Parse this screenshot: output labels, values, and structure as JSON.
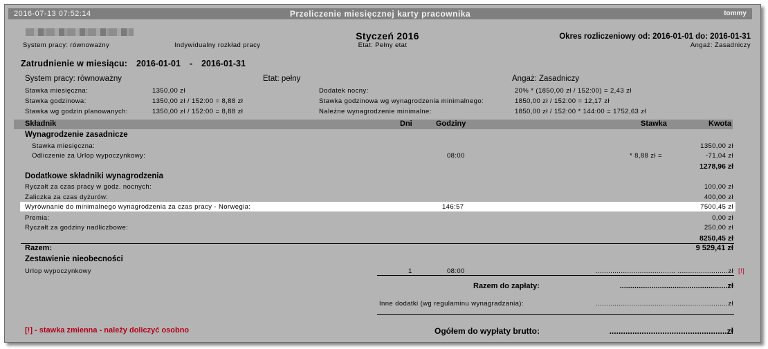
{
  "window": {
    "datetime": "2016-07-13  07:52:14",
    "title": "Przeliczenie miesięcznej karty pracownika",
    "user": "tommy"
  },
  "header": {
    "month": "Styczeń 2016",
    "etat": "Etat: Pełny etat",
    "system": "System pracy: równoważny",
    "rozklad": "Indywidualny rozkład pracy",
    "okres": "Okres rozliczeniowy od: 2016-01-01 do: 2016-01-31",
    "angaz": "Angaż: Zasadniczy"
  },
  "employment": {
    "label": "Zatrudnienie w miesiącu:",
    "from": "2016-01-01",
    "sep": "-",
    "to": "2016-01-31"
  },
  "summary": {
    "system": "System pracy: równoważny",
    "etat": "Etat: pełny",
    "angaz": "Angaż: Zasadniczy",
    "stawka_mies_l": "Stawka miesięczna:",
    "stawka_mies_v": "1350,00 zł",
    "stawka_godz_l": "Stawka godzinowa:",
    "stawka_godz_v": "1350,00 zł / 152:00 = 8,88 zł",
    "stawka_plan_l": "Stawka wg godzin planowanych:",
    "stawka_plan_v": "1350,00 zł / 152:00 = 8,88 zł",
    "dodatek_l": "Dodatek nocny:",
    "dodatek_v": "20% * (1850,00 zł / 152:00) = 2,43 zł",
    "stawka_min_l": "Stawka godzinowa wg wynagrodzenia minimalnego:",
    "stawka_min_v": "1850,00 zł / 152:00 = 12,17 zł",
    "nalezne_l": "Należne wynagrodzenie minimalne:",
    "nalezne_v": "1850,00 zł / 152:00 * 144:00 = 1752,63 zł"
  },
  "table_header": {
    "skladnik": "Składnik",
    "dni": "Dni",
    "godziny": "Godziny",
    "stawka": "Stawka",
    "kwota": "Kwota"
  },
  "section1": {
    "title": "Wynagrodzenie zasadnicze",
    "r1_l": "Stawka miesięczna:",
    "r1_k": "1350,00 zł",
    "r2_l": "Odliczenie za Urlop wypoczynkowy:",
    "r2_g": "08:00",
    "r2_s": "* 8,88 zł =",
    "r2_k": "-71,04 zł",
    "subtotal": "1278,96 zł"
  },
  "section2": {
    "title": "Dodatkowe składniki wynagrodzenia",
    "r1_l": "Ryczałt za czas pracy w godz. nocnych:",
    "r1_k": "100,00 zł",
    "r2_l": "Zaliczka za czas dyżurów:",
    "r2_k": "400,00 zł",
    "r3_l": "Wyrównanie do minimalnego wynagrodzenia za czas pracy - Norwegia:",
    "r3_g": "146:57",
    "r3_k": "7500,45 zł",
    "r4_l": "Premia:",
    "r4_k": "0,00 zł",
    "r5_l": "Ryczałt za godziny nadliczbowe:",
    "r5_k": "250,00 zł",
    "subtotal": "8250,45 zł"
  },
  "razem": {
    "label": "Razem:",
    "value": "9 529,41 zł"
  },
  "absences": {
    "title": "Zestawienie nieobecności",
    "r1_l": "Urlop wypoczynkowy",
    "r1_d": "1",
    "r1_g": "08:00",
    "r1_dots": "...................................... ........................zł",
    "flag": "[!]"
  },
  "totals": {
    "zaplaty_l": "Razem do zapłaty:",
    "zaplaty_v": "...................................................zł",
    "inne_l": "Inne dodatki (wg regulaminu wynagradzania):",
    "inne_v": "...............................................................zł",
    "brutto_l": "Ogółem do wypłaty brutto:",
    "brutto_v": "...................................................zł"
  },
  "footnote": "[!] - stawka zmienna - należy doliczyć osobno"
}
